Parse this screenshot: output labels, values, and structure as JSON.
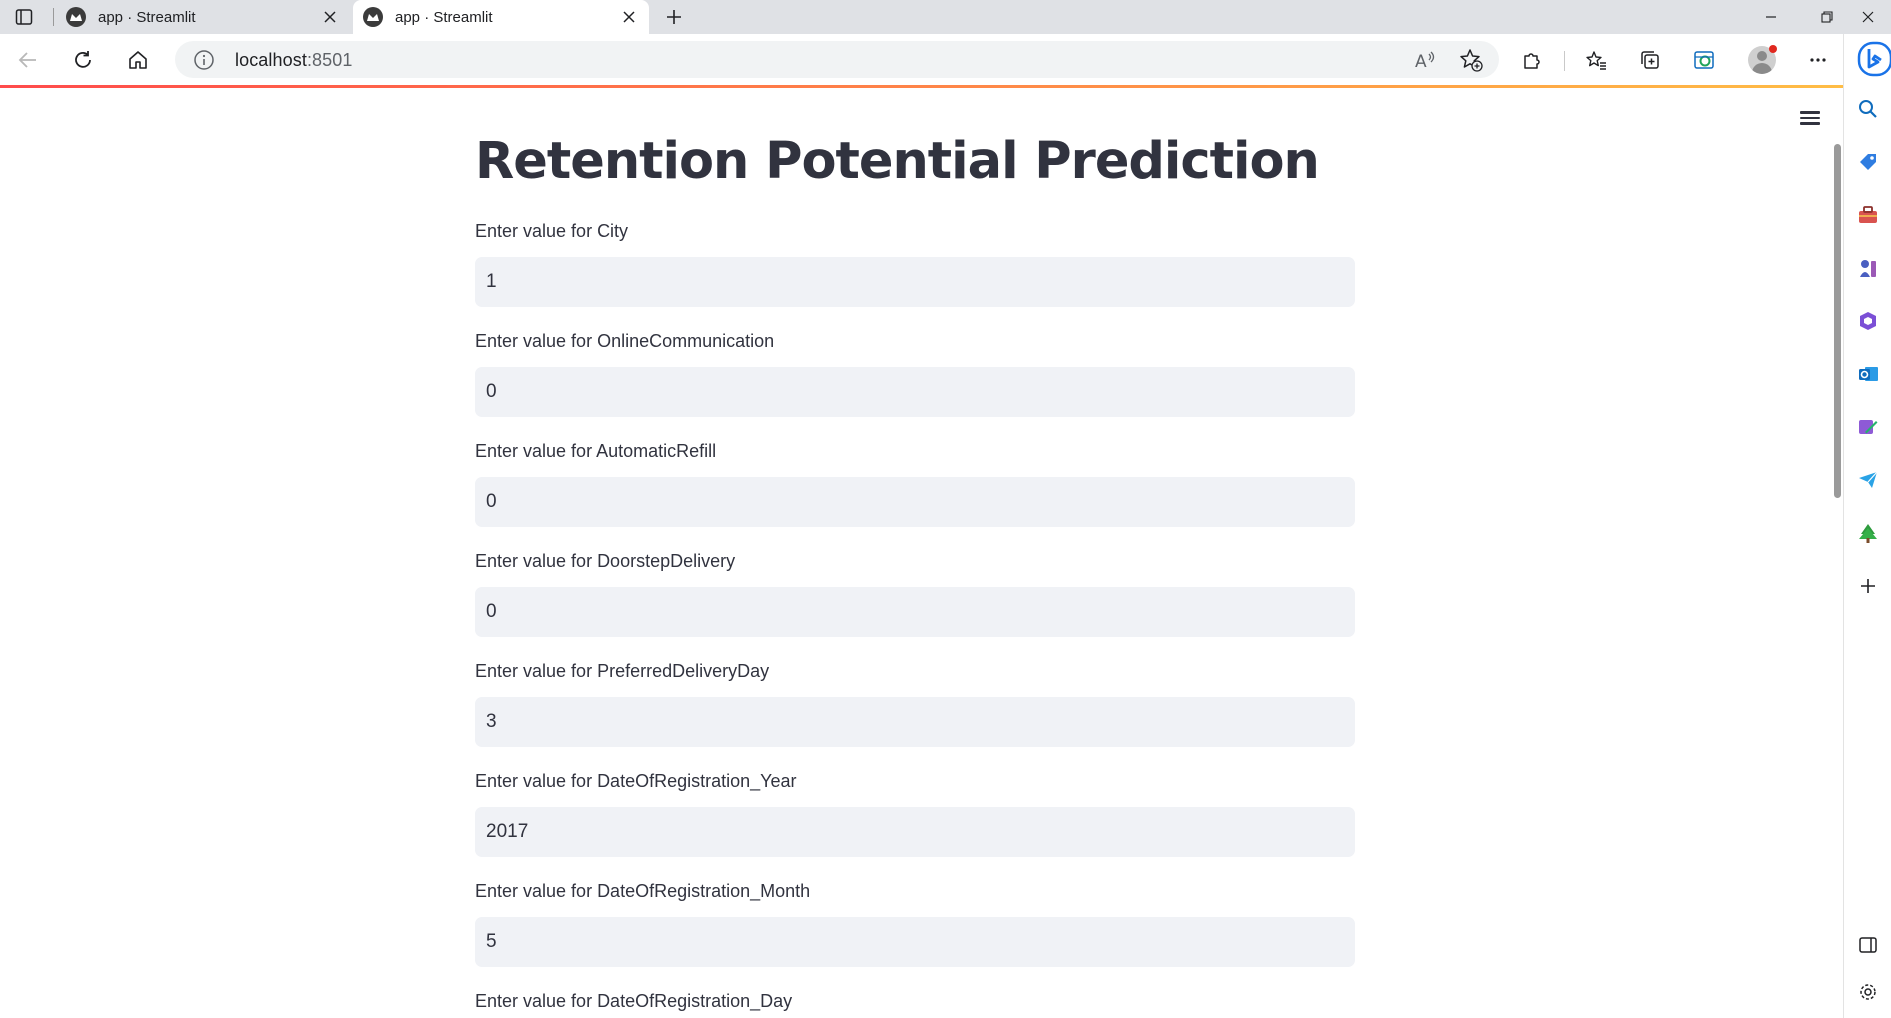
{
  "browser": {
    "tabs": [
      {
        "title": "app · Streamlit",
        "active": false
      },
      {
        "title": "app · Streamlit",
        "active": true
      }
    ],
    "address": {
      "host": "localhost",
      "port": ":8501"
    }
  },
  "app": {
    "title": "Retention Potential Prediction",
    "fields": [
      {
        "label": "Enter value for City",
        "value": "1"
      },
      {
        "label": "Enter value for OnlineCommunication",
        "value": "0"
      },
      {
        "label": "Enter value for AutomaticRefill",
        "value": "0"
      },
      {
        "label": "Enter value for DoorstepDelivery",
        "value": "0"
      },
      {
        "label": "Enter value for PreferredDeliveryDay",
        "value": "3"
      },
      {
        "label": "Enter value for DateOfRegistration_Year",
        "value": "2017"
      },
      {
        "label": "Enter value for DateOfRegistration_Month",
        "value": "5"
      },
      {
        "label": "Enter value for DateOfRegistration_Day",
        "value": ""
      }
    ]
  },
  "colors": {
    "text": "#31333f",
    "input_bg": "#f0f2f6",
    "accent_gradient_start": "#ff4b4b",
    "accent_gradient_end": "#ffbd45"
  },
  "icons": {
    "sidebar": [
      "search-icon",
      "shopping-tag-icon",
      "toolbox-icon",
      "games-icon",
      "office-icon",
      "outlook-icon",
      "designer-icon",
      "telegram-icon",
      "tree-icon",
      "add-icon",
      "split-screen-icon",
      "settings-icon"
    ]
  }
}
